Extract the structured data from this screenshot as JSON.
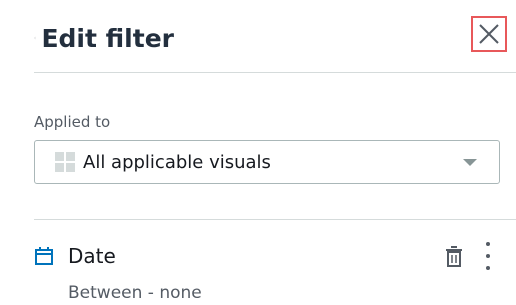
{
  "header": {
    "title": "Edit filter",
    "back_icon": "chevron-left-icon",
    "close_icon": "close-icon",
    "close_highlight_color": "#e8585a"
  },
  "applied_to": {
    "label": "Applied to",
    "selected_value": "All applicable visuals",
    "value_icon": "grid-icon",
    "dropdown_icon": "caret-down-icon"
  },
  "filter": {
    "icon": "calendar-icon",
    "icon_color": "#0073bb",
    "name": "Date",
    "description": "Between - none",
    "delete_icon": "trash-icon",
    "menu_icon": "more-vertical-icon"
  }
}
